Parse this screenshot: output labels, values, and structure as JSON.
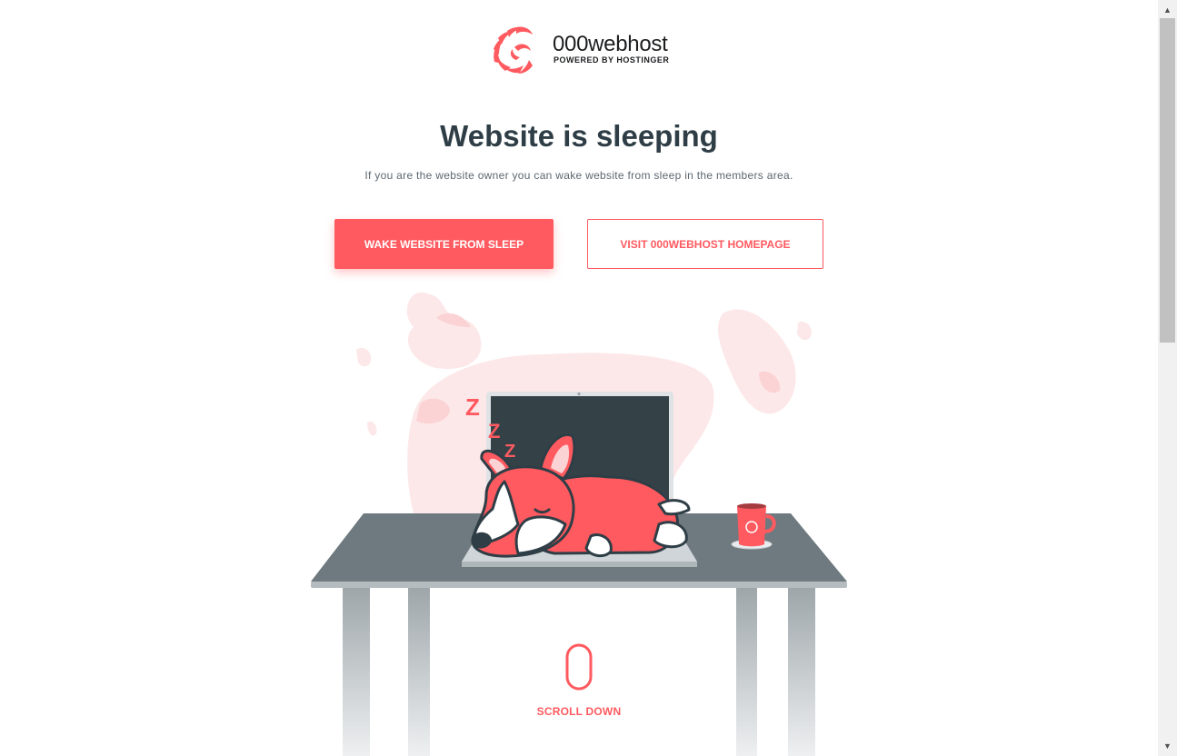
{
  "brand": {
    "name": "000webhost",
    "tagline": "POWERED BY HOSTINGER",
    "accent_color": "#ff5a5f",
    "heading_color": "#2f3e46"
  },
  "hero": {
    "title": "Website is sleeping",
    "subtitle": "If you are the website owner you can wake website from sleep in the members area."
  },
  "actions": {
    "wake_label": "WAKE WEBSITE FROM SLEEP",
    "visit_label": "VISIT 000WEBHOST HOMEPAGE"
  },
  "illustration": {
    "sleep_letters": [
      "Z",
      "Z",
      "Z"
    ],
    "icons": [
      "sleeping-dog-icon",
      "laptop-icon",
      "desk-icon",
      "coffee-mug-icon"
    ]
  },
  "scroll": {
    "label": "SCROLL DOWN",
    "icon": "mouse-icon"
  }
}
